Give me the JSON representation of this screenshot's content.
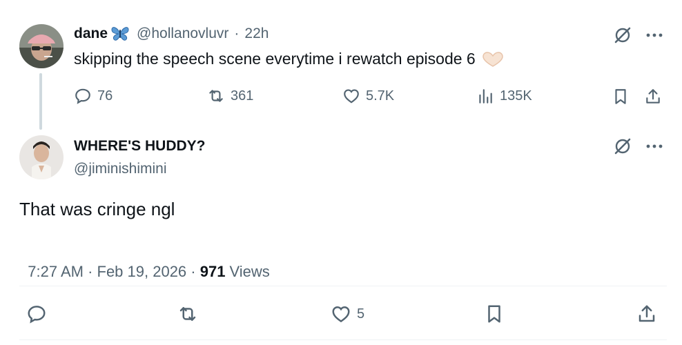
{
  "parent_tweet": {
    "display_name": "dane",
    "name_emoji": "butterfly",
    "handle": "@hollanovluvr",
    "separator": "·",
    "time_ago": "22h",
    "text": "skipping the speech scene everytime i rewatch episode 6",
    "text_emoji": "heart-hands",
    "replies": "76",
    "reposts": "361",
    "likes": "5.7K",
    "views": "135K"
  },
  "reply_tweet": {
    "display_name": "WHERE'S HUDDY?",
    "handle": "@jiminishimini",
    "text": "That was cringe ngl",
    "timestamp": "7:27 AM · Feb 19, 2026 · ",
    "views_count": "971",
    "views_label": "Views",
    "likes": "5"
  },
  "colors": {
    "text": "#0f1419",
    "muted": "#536471",
    "divider": "#eff3f4",
    "thread_line": "#cfd9de",
    "butterfly": "#5b9bd5"
  }
}
